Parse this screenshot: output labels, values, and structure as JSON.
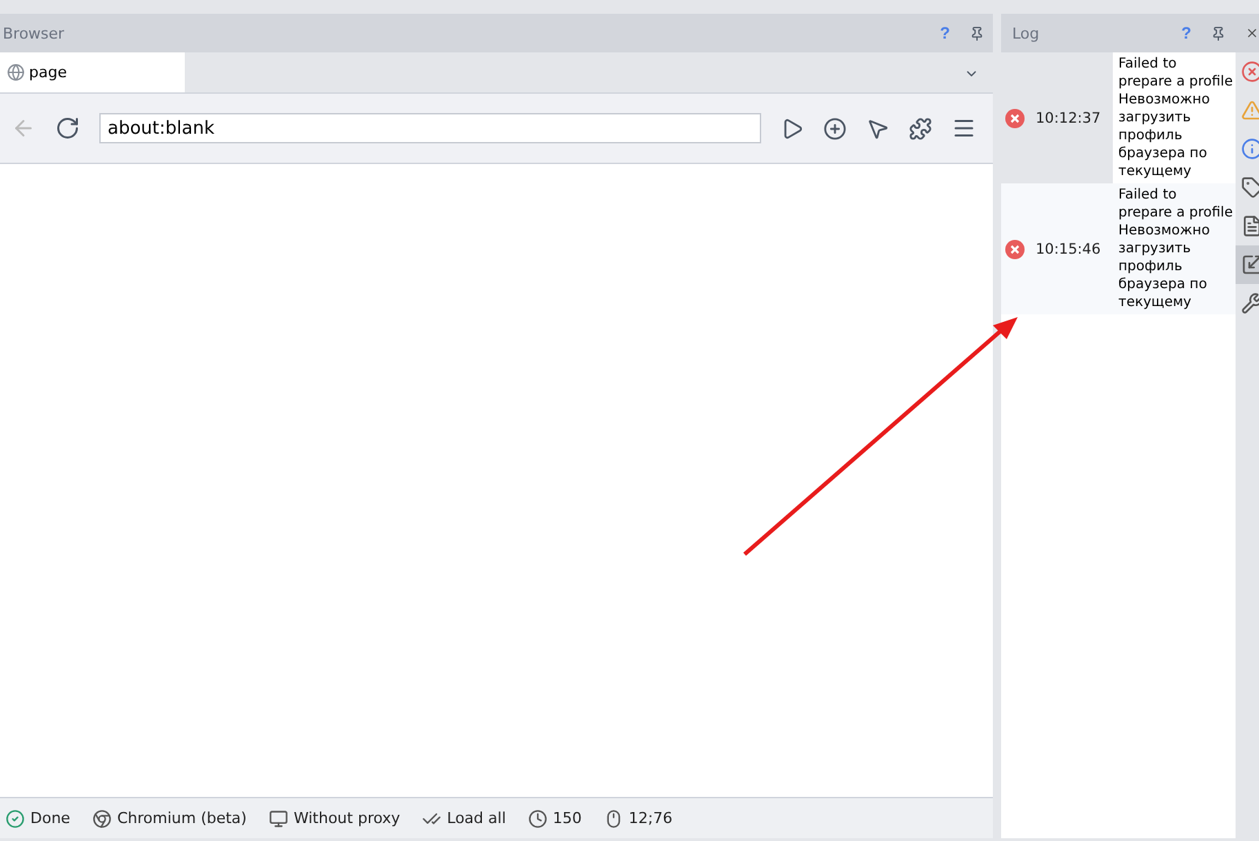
{
  "browser": {
    "title": "Browser",
    "help": "?",
    "tabs": [
      {
        "label": "page",
        "selected": true
      }
    ],
    "address": {
      "value": "about:blank"
    },
    "status_bar": [
      {
        "kind": "done",
        "label": "Done"
      },
      {
        "kind": "engine",
        "label": "Chromium (beta)"
      },
      {
        "kind": "proxy",
        "label": "Without proxy"
      },
      {
        "kind": "load",
        "label": "Load all"
      },
      {
        "kind": "timeout",
        "label": "150"
      },
      {
        "kind": "cursor",
        "label": "12;76"
      }
    ]
  },
  "log": {
    "title": "Log",
    "help": "?",
    "entries": [
      {
        "kind": "error",
        "time": "10:12:37",
        "message": "Failed to prepare a profile Невозможно загрузить профиль браузера по текущему",
        "selected": true
      },
      {
        "kind": "error",
        "time": "10:15:46",
        "message": "Failed to prepare a profile Невозможно загрузить профиль браузера по текущему",
        "selected": false
      }
    ],
    "filters": [
      {
        "kind": "error",
        "selected": false
      },
      {
        "kind": "warning",
        "selected": false
      },
      {
        "kind": "info",
        "selected": false
      },
      {
        "kind": "tag",
        "selected": false
      },
      {
        "kind": "document",
        "selected": false
      },
      {
        "kind": "expand",
        "selected": true
      },
      {
        "kind": "tools",
        "selected": false
      }
    ]
  }
}
